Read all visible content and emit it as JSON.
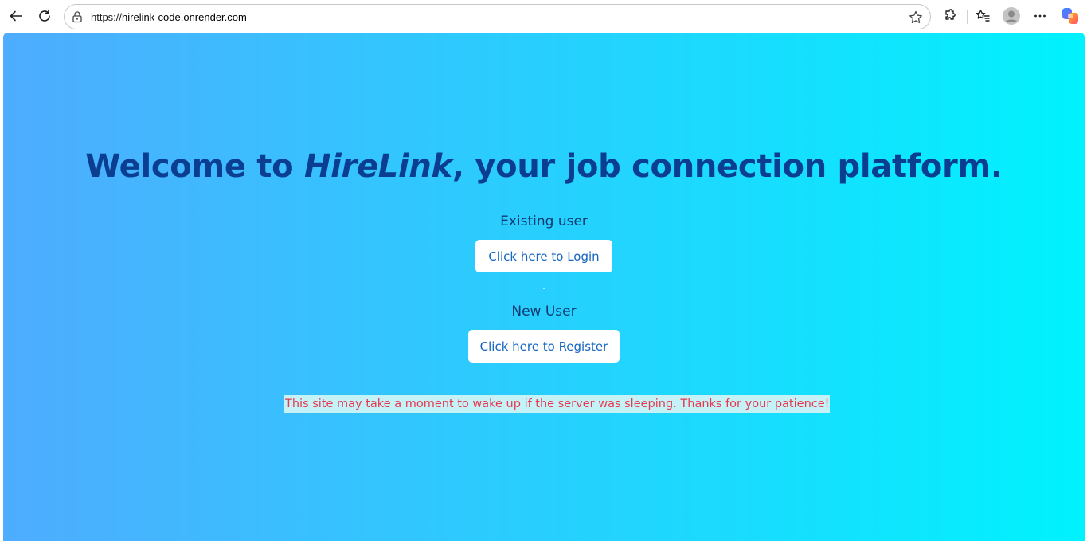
{
  "browser": {
    "url_scheme": "https://",
    "url_domain": "hirelink-code.onrender.com",
    "icons": [
      "back-icon",
      "reload-icon",
      "lock-icon",
      "star-icon",
      "extensions-icon",
      "favorites-icon",
      "profile-avatar",
      "more-icon",
      "copilot-icon"
    ]
  },
  "page": {
    "heading_prefix": "Welcome to ",
    "heading_brand": "HireLink",
    "heading_suffix": ", your job connection platform.",
    "existing_user_label": "Existing user",
    "login_button": "Click here to Login",
    "new_user_label": "New User",
    "register_button": "Click here to Register",
    "notice": "This site may take a moment to wake up if the server was sleeping. Thanks for your patience!"
  },
  "colors": {
    "gradient_start": "#4facfe",
    "gradient_end": "#00f2fe",
    "heading": "#0b3d91",
    "button_text": "#1565c0",
    "notice_text": "#e63950",
    "notice_bg": "#c5f2f6"
  }
}
